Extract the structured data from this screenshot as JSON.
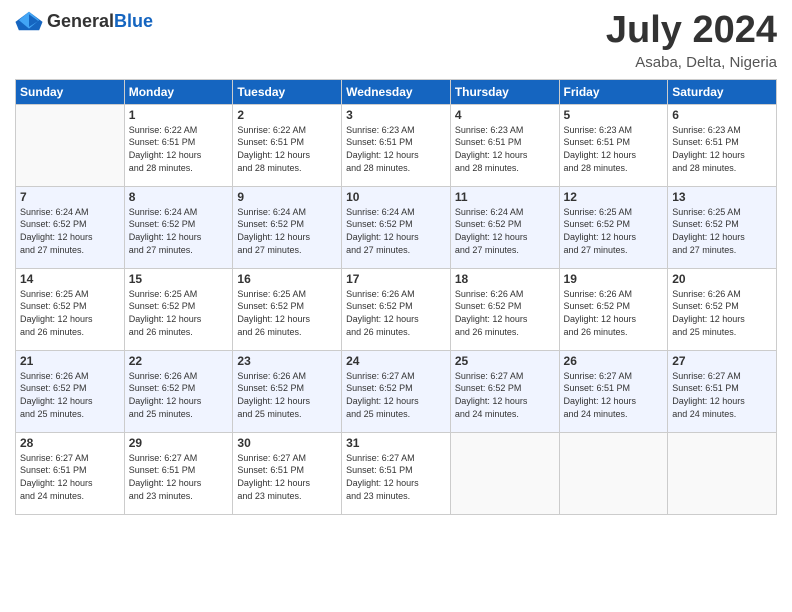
{
  "header": {
    "logo_general": "General",
    "logo_blue": "Blue",
    "month_year": "July 2024",
    "location": "Asaba, Delta, Nigeria"
  },
  "weekdays": [
    "Sunday",
    "Monday",
    "Tuesday",
    "Wednesday",
    "Thursday",
    "Friday",
    "Saturday"
  ],
  "weeks": [
    [
      {
        "day": "",
        "sunrise": "",
        "sunset": "",
        "daylight": ""
      },
      {
        "day": "1",
        "sunrise": "Sunrise: 6:22 AM",
        "sunset": "Sunset: 6:51 PM",
        "daylight": "Daylight: 12 hours and 28 minutes."
      },
      {
        "day": "2",
        "sunrise": "Sunrise: 6:22 AM",
        "sunset": "Sunset: 6:51 PM",
        "daylight": "Daylight: 12 hours and 28 minutes."
      },
      {
        "day": "3",
        "sunrise": "Sunrise: 6:23 AM",
        "sunset": "Sunset: 6:51 PM",
        "daylight": "Daylight: 12 hours and 28 minutes."
      },
      {
        "day": "4",
        "sunrise": "Sunrise: 6:23 AM",
        "sunset": "Sunset: 6:51 PM",
        "daylight": "Daylight: 12 hours and 28 minutes."
      },
      {
        "day": "5",
        "sunrise": "Sunrise: 6:23 AM",
        "sunset": "Sunset: 6:51 PM",
        "daylight": "Daylight: 12 hours and 28 minutes."
      },
      {
        "day": "6",
        "sunrise": "Sunrise: 6:23 AM",
        "sunset": "Sunset: 6:51 PM",
        "daylight": "Daylight: 12 hours and 28 minutes."
      }
    ],
    [
      {
        "day": "7",
        "sunrise": "Sunrise: 6:24 AM",
        "sunset": "Sunset: 6:52 PM",
        "daylight": "Daylight: 12 hours and 27 minutes."
      },
      {
        "day": "8",
        "sunrise": "Sunrise: 6:24 AM",
        "sunset": "Sunset: 6:52 PM",
        "daylight": "Daylight: 12 hours and 27 minutes."
      },
      {
        "day": "9",
        "sunrise": "Sunrise: 6:24 AM",
        "sunset": "Sunset: 6:52 PM",
        "daylight": "Daylight: 12 hours and 27 minutes."
      },
      {
        "day": "10",
        "sunrise": "Sunrise: 6:24 AM",
        "sunset": "Sunset: 6:52 PM",
        "daylight": "Daylight: 12 hours and 27 minutes."
      },
      {
        "day": "11",
        "sunrise": "Sunrise: 6:24 AM",
        "sunset": "Sunset: 6:52 PM",
        "daylight": "Daylight: 12 hours and 27 minutes."
      },
      {
        "day": "12",
        "sunrise": "Sunrise: 6:25 AM",
        "sunset": "Sunset: 6:52 PM",
        "daylight": "Daylight: 12 hours and 27 minutes."
      },
      {
        "day": "13",
        "sunrise": "Sunrise: 6:25 AM",
        "sunset": "Sunset: 6:52 PM",
        "daylight": "Daylight: 12 hours and 27 minutes."
      }
    ],
    [
      {
        "day": "14",
        "sunrise": "Sunrise: 6:25 AM",
        "sunset": "Sunset: 6:52 PM",
        "daylight": "Daylight: 12 hours and 26 minutes."
      },
      {
        "day": "15",
        "sunrise": "Sunrise: 6:25 AM",
        "sunset": "Sunset: 6:52 PM",
        "daylight": "Daylight: 12 hours and 26 minutes."
      },
      {
        "day": "16",
        "sunrise": "Sunrise: 6:25 AM",
        "sunset": "Sunset: 6:52 PM",
        "daylight": "Daylight: 12 hours and 26 minutes."
      },
      {
        "day": "17",
        "sunrise": "Sunrise: 6:26 AM",
        "sunset": "Sunset: 6:52 PM",
        "daylight": "Daylight: 12 hours and 26 minutes."
      },
      {
        "day": "18",
        "sunrise": "Sunrise: 6:26 AM",
        "sunset": "Sunset: 6:52 PM",
        "daylight": "Daylight: 12 hours and 26 minutes."
      },
      {
        "day": "19",
        "sunrise": "Sunrise: 6:26 AM",
        "sunset": "Sunset: 6:52 PM",
        "daylight": "Daylight: 12 hours and 26 minutes."
      },
      {
        "day": "20",
        "sunrise": "Sunrise: 6:26 AM",
        "sunset": "Sunset: 6:52 PM",
        "daylight": "Daylight: 12 hours and 25 minutes."
      }
    ],
    [
      {
        "day": "21",
        "sunrise": "Sunrise: 6:26 AM",
        "sunset": "Sunset: 6:52 PM",
        "daylight": "Daylight: 12 hours and 25 minutes."
      },
      {
        "day": "22",
        "sunrise": "Sunrise: 6:26 AM",
        "sunset": "Sunset: 6:52 PM",
        "daylight": "Daylight: 12 hours and 25 minutes."
      },
      {
        "day": "23",
        "sunrise": "Sunrise: 6:26 AM",
        "sunset": "Sunset: 6:52 PM",
        "daylight": "Daylight: 12 hours and 25 minutes."
      },
      {
        "day": "24",
        "sunrise": "Sunrise: 6:27 AM",
        "sunset": "Sunset: 6:52 PM",
        "daylight": "Daylight: 12 hours and 25 minutes."
      },
      {
        "day": "25",
        "sunrise": "Sunrise: 6:27 AM",
        "sunset": "Sunset: 6:52 PM",
        "daylight": "Daylight: 12 hours and 24 minutes."
      },
      {
        "day": "26",
        "sunrise": "Sunrise: 6:27 AM",
        "sunset": "Sunset: 6:51 PM",
        "daylight": "Daylight: 12 hours and 24 minutes."
      },
      {
        "day": "27",
        "sunrise": "Sunrise: 6:27 AM",
        "sunset": "Sunset: 6:51 PM",
        "daylight": "Daylight: 12 hours and 24 minutes."
      }
    ],
    [
      {
        "day": "28",
        "sunrise": "Sunrise: 6:27 AM",
        "sunset": "Sunset: 6:51 PM",
        "daylight": "Daylight: 12 hours and 24 minutes."
      },
      {
        "day": "29",
        "sunrise": "Sunrise: 6:27 AM",
        "sunset": "Sunset: 6:51 PM",
        "daylight": "Daylight: 12 hours and 23 minutes."
      },
      {
        "day": "30",
        "sunrise": "Sunrise: 6:27 AM",
        "sunset": "Sunset: 6:51 PM",
        "daylight": "Daylight: 12 hours and 23 minutes."
      },
      {
        "day": "31",
        "sunrise": "Sunrise: 6:27 AM",
        "sunset": "Sunset: 6:51 PM",
        "daylight": "Daylight: 12 hours and 23 minutes."
      },
      {
        "day": "",
        "sunrise": "",
        "sunset": "",
        "daylight": ""
      },
      {
        "day": "",
        "sunrise": "",
        "sunset": "",
        "daylight": ""
      },
      {
        "day": "",
        "sunrise": "",
        "sunset": "",
        "daylight": ""
      }
    ]
  ]
}
